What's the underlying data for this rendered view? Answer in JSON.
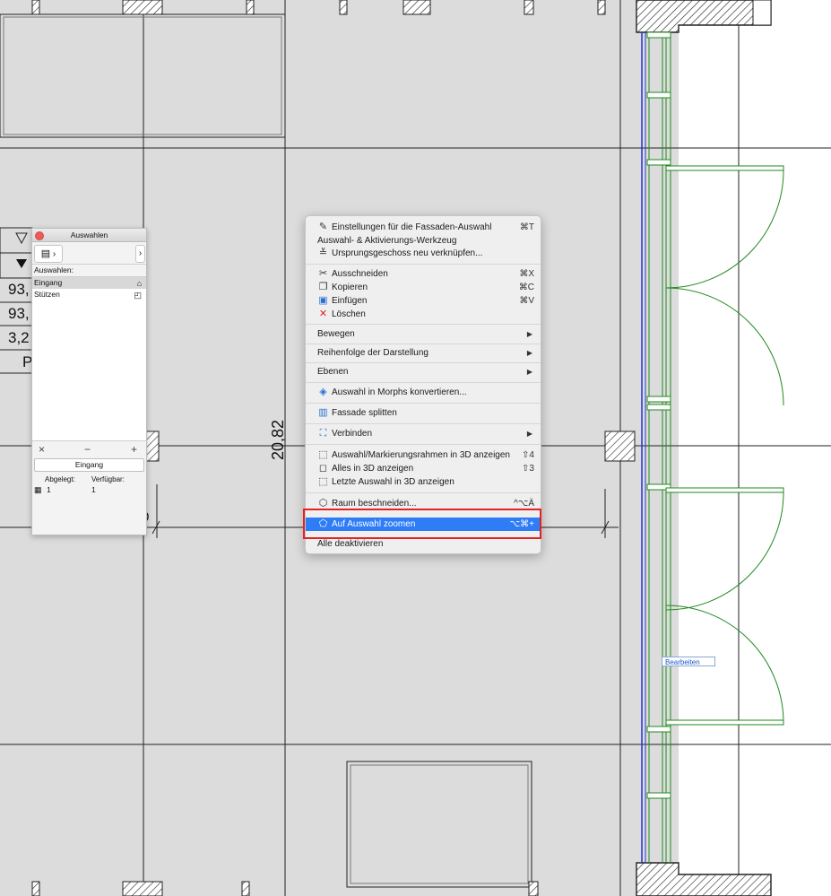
{
  "drawing": {
    "dimension_label": "20,82",
    "dimension_fragment": "0",
    "left_values": [
      "93,",
      "93,",
      "3,2",
      "P"
    ],
    "tag_label": "Bearbeiten"
  },
  "palette": {
    "title": "Auswahlen",
    "header": "Auswahlen:",
    "items": [
      {
        "label": "Eingang",
        "icon": "house-icon"
      },
      {
        "label": "Stützen",
        "icon": "plan-icon"
      }
    ],
    "remove_symbol": "×",
    "minus_symbol": "−",
    "add_symbol": "+",
    "name_button": "Eingang",
    "col_stored": "Abgelegt:",
    "col_available": "Verfügbar:",
    "stored_value": "1",
    "available_value": "1",
    "nav_arrow": "›"
  },
  "menu": {
    "items": [
      {
        "label": "Einstellungen für die Fassaden-Auswahl",
        "shortcut": "⌘T",
        "icon": "settings-icon"
      },
      {
        "label": "Auswahl- & Aktivierungs-Werkzeug",
        "shortcut": "",
        "icon": ""
      },
      {
        "label": "Ursprungsgeschoss neu verknüpfen...",
        "shortcut": "",
        "icon": "story-icon"
      },
      {
        "label": "Ausschneiden",
        "shortcut": "⌘X",
        "icon": "scissors-icon"
      },
      {
        "label": "Kopieren",
        "shortcut": "⌘C",
        "icon": "copy-icon"
      },
      {
        "label": "Einfügen",
        "shortcut": "⌘V",
        "icon": "paste-icon"
      },
      {
        "label": "Löschen",
        "shortcut": "",
        "icon": "delete-icon"
      },
      {
        "label": "Bewegen",
        "shortcut": "",
        "icon": "",
        "submenu": true
      },
      {
        "label": "Reihenfolge der Darstellung",
        "shortcut": "",
        "icon": "",
        "submenu": true
      },
      {
        "label": "Ebenen",
        "shortcut": "",
        "icon": "",
        "submenu": true
      },
      {
        "label": "Auswahl in Morphs konvertieren...",
        "shortcut": "",
        "icon": "morph-icon"
      },
      {
        "label": "Fassade splitten",
        "shortcut": "",
        "icon": "split-icon"
      },
      {
        "label": "Verbinden",
        "shortcut": "",
        "icon": "connect-icon",
        "submenu": true
      },
      {
        "label": "Auswahl/Markierungsrahmen in 3D anzeigen",
        "shortcut": "⇧4",
        "icon": "3d-selection-icon"
      },
      {
        "label": "Alles in 3D anzeigen",
        "shortcut": "⇧3",
        "icon": "3d-all-icon"
      },
      {
        "label": "Letzte Auswahl in 3D anzeigen",
        "shortcut": "",
        "icon": "3d-last-icon"
      },
      {
        "label": "Raum beschneiden...",
        "shortcut": "^⌥Ä",
        "icon": "trim-icon"
      },
      {
        "label": "Auf Auswahl zoomen",
        "shortcut": "⌥⌘+",
        "icon": "zoom-selection-icon",
        "highlighted": true
      },
      {
        "label": "Alle deaktivieren",
        "shortcut": "",
        "icon": ""
      }
    ]
  },
  "colors": {
    "highlight": "#2e7cf6",
    "callout": "#e52222",
    "wall_green": "#1f8a1f",
    "line_blue": "#2233cc"
  }
}
